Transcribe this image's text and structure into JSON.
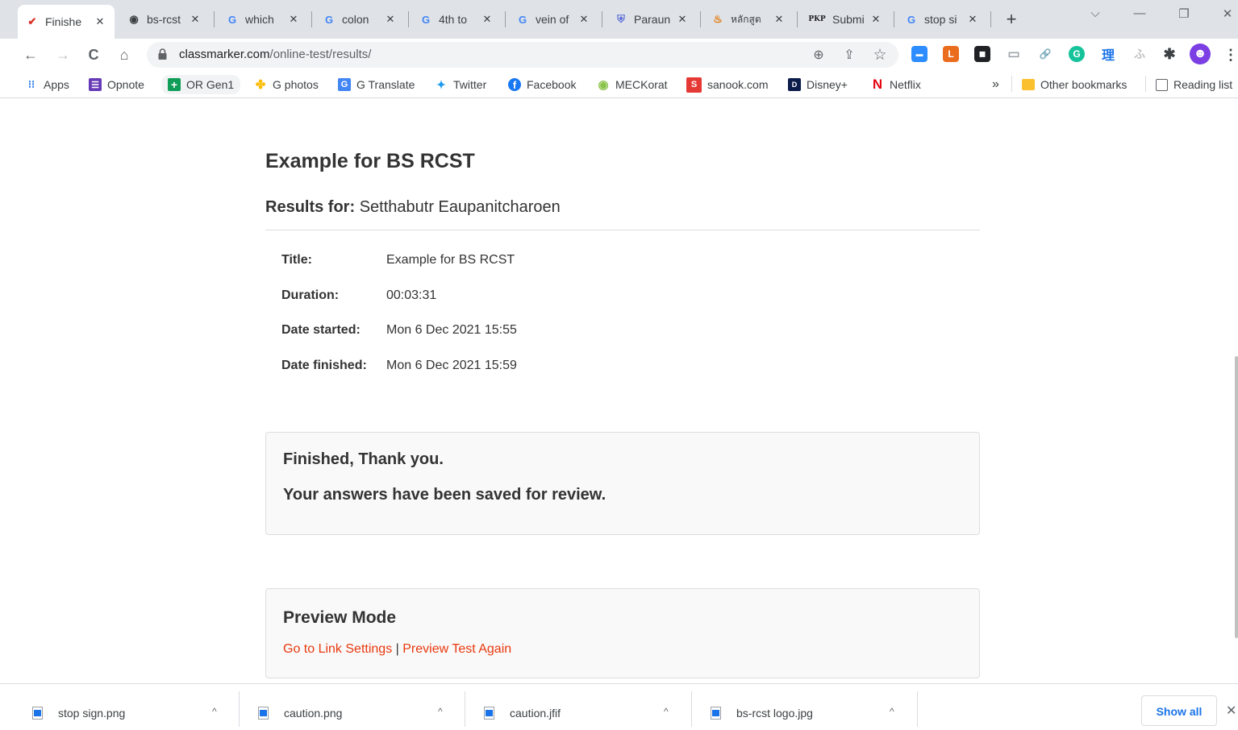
{
  "browser": {
    "tabs": [
      {
        "title": "Finishe",
        "favicon": "✔",
        "favicon_color": "#d93025"
      },
      {
        "title": "bs-rcst",
        "favicon": "◉",
        "favicon_color": "#3c4043"
      },
      {
        "title": "which",
        "favicon": "G",
        "favicon_color": "#4285f4"
      },
      {
        "title": "colon",
        "favicon": "G",
        "favicon_color": "#4285f4"
      },
      {
        "title": "4th to",
        "favicon": "G",
        "favicon_color": "#4285f4"
      },
      {
        "title": "vein of",
        "favicon": "G",
        "favicon_color": "#4285f4"
      },
      {
        "title": "Paraun",
        "favicon": "⛨",
        "favicon_color": "#5b6bd6"
      },
      {
        "title": "หลักสูต",
        "favicon": "♨",
        "favicon_color": "#e37400"
      },
      {
        "title": "Submi",
        "favicon": "PKP",
        "favicon_color": "#202124"
      },
      {
        "title": "stop si",
        "favicon": "G",
        "favicon_color": "#4285f4"
      }
    ],
    "tab_close_glyph": "✕",
    "new_tab_glyph": "+",
    "window_controls": {
      "dropdown": "⌵",
      "minimize": "—",
      "restore": "❐",
      "close": "✕"
    },
    "nav": {
      "back": "←",
      "forward": "→",
      "reload": "C",
      "home": "⌂"
    },
    "address": {
      "domain": "classmarker.com",
      "path": "/online-test/results/"
    },
    "omnibox_icons": {
      "zoom": "⊕",
      "share": "⇪",
      "star": "☆"
    },
    "extensions": [
      {
        "name": "zoom",
        "glyph": "▬",
        "color": "#2d8cff"
      },
      {
        "name": "office",
        "glyph": "L",
        "color": "#ea6c1d"
      },
      {
        "name": "screen",
        "glyph": "◼",
        "color": "#202124"
      },
      {
        "name": "doc",
        "glyph": "▭",
        "color": "#9aa0a6"
      },
      {
        "name": "link",
        "glyph": "🔗",
        "color": "#ffffff"
      },
      {
        "name": "grammarly",
        "glyph": "G",
        "color": "#15c39a"
      },
      {
        "name": "kanji",
        "glyph": "理",
        "color": "#ffffff"
      },
      {
        "name": "faded",
        "glyph": "ふ",
        "color": "#ffffff"
      },
      {
        "name": "puzzle",
        "glyph": "✱",
        "color": "#ffffff"
      },
      {
        "name": "profile",
        "glyph": "☻",
        "color": "#7b3fe4"
      }
    ],
    "menu_glyph": "⋮"
  },
  "bookmarks": [
    {
      "label": "Apps",
      "glyph": "⁝⁝",
      "color": "#1a73e8"
    },
    {
      "label": "Opnote",
      "glyph": "☰",
      "color": "#673ab7"
    },
    {
      "label": "OR Gen1",
      "glyph": "+",
      "color": "#0f9d58"
    },
    {
      "label": "G photos",
      "glyph": "✤",
      "color": "#fbbc04"
    },
    {
      "label": "G Translate",
      "glyph": "G",
      "color": "#4285f4"
    },
    {
      "label": "Twitter",
      "glyph": "✦",
      "color": "#1d9bf0"
    },
    {
      "label": "Facebook",
      "glyph": "f",
      "color": "#1877f2"
    },
    {
      "label": "MECKorat",
      "glyph": "◉",
      "color": "#8bc34a"
    },
    {
      "label": "sanook.com",
      "glyph": "S",
      "color": "#e53935"
    },
    {
      "label": "Disney+",
      "glyph": "D",
      "color": "#0b1c4a"
    },
    {
      "label": "Netflix",
      "glyph": "N",
      "color": "#e50914"
    }
  ],
  "bookmarks_overflow": "»",
  "other_bookmarks": "Other bookmarks",
  "reading_list": "Reading list",
  "page": {
    "title": "Example for BS RCST",
    "results_label": "Results for:",
    "results_name": "Setthabutr Eaupanitcharoen",
    "info": [
      {
        "label": "Title:",
        "value": "Example for BS RCST"
      },
      {
        "label": "Duration:",
        "value": "00:03:31"
      },
      {
        "label": "Date started:",
        "value": "Mon 6 Dec 2021 15:55"
      },
      {
        "label": "Date finished:",
        "value": "Mon 6 Dec 2021 15:59"
      }
    ],
    "finished_line1": "Finished, Thank you.",
    "finished_line2": "Your answers have been saved for review.",
    "preview_title": "Preview Mode",
    "preview_link1": "Go to Link Settings",
    "preview_sep": "|",
    "preview_link2": "Preview Test Again"
  },
  "downloads": [
    {
      "name": "stop sign.png"
    },
    {
      "name": "caution.png"
    },
    {
      "name": "caution.jfif"
    },
    {
      "name": "bs-rcst logo.jpg"
    }
  ],
  "download_chevron": "^",
  "show_all": "Show all",
  "shelf_close": "✕"
}
